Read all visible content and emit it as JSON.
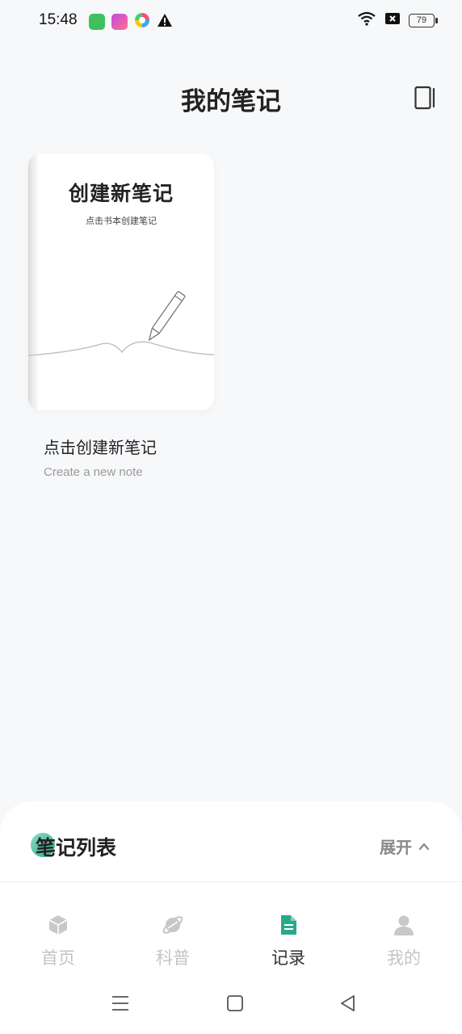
{
  "status_bar": {
    "time": "15:48",
    "battery": "79",
    "icons": [
      "app-green-icon",
      "app-purple-icon",
      "app-colorful-icon",
      "warning-icon",
      "wifi-icon",
      "sim-disabled-icon",
      "battery-icon"
    ]
  },
  "header": {
    "title": "我的笔记",
    "action_icon": "book-switch-icon"
  },
  "notebook": {
    "cover_title": "创建新笔记",
    "cover_subtitle": "点击书本创建笔记",
    "label": "点击创建新笔记",
    "sublabel": "Create a new note"
  },
  "sheet": {
    "title": "笔记列表",
    "expand_label": "展开"
  },
  "tabs": [
    {
      "label": "首页",
      "icon": "cube-icon",
      "active": false
    },
    {
      "label": "科普",
      "icon": "planet-icon",
      "active": false
    },
    {
      "label": "记录",
      "icon": "document-icon",
      "active": true
    },
    {
      "label": "我的",
      "icon": "person-icon",
      "active": false
    }
  ],
  "colors": {
    "accent": "#2aa98a",
    "background": "#f7f8fa",
    "inactive_tab": "#c4c4c4"
  }
}
